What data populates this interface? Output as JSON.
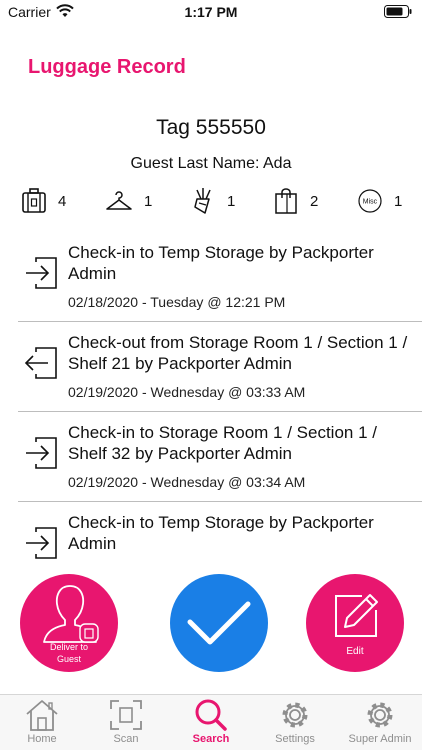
{
  "status_bar": {
    "carrier": "Carrier",
    "time": "1:17 PM"
  },
  "header": {
    "title": "Luggage Record"
  },
  "record": {
    "tag": "Tag 555550",
    "guest": "Guest Last Name: Ada"
  },
  "counts": [
    {
      "icon": "suitcase-icon",
      "value": "4"
    },
    {
      "icon": "hanger-icon",
      "value": "1"
    },
    {
      "icon": "golf-bag-icon",
      "value": "1"
    },
    {
      "icon": "shopping-bag-icon",
      "value": "2"
    },
    {
      "icon": "misc-icon",
      "value": "1",
      "icon_text": "Misc"
    }
  ],
  "history": [
    {
      "direction": "in",
      "text": "Check-in to Temp Storage by Packporter Admin",
      "date": "02/18/2020 - Tuesday @ 12:21 PM"
    },
    {
      "direction": "out",
      "text": "Check-out from Storage Room 1 / Section 1 / Shelf 21 by Packporter Admin",
      "date": "02/19/2020 - Wednesday @ 03:33 AM"
    },
    {
      "direction": "in",
      "text": "Check-in to Storage Room 1 / Section 1 / Shelf 32 by Packporter Admin",
      "date": "02/19/2020 - Wednesday @ 03:34 AM"
    },
    {
      "direction": "in",
      "text": "Check-in to Temp Storage by Packporter Admin",
      "date": ""
    }
  ],
  "actions": {
    "deliver_line1": "Deliver to",
    "deliver_line2": "Guest",
    "edit": "Edit"
  },
  "tabs": [
    {
      "label": "Home",
      "icon": "home-icon"
    },
    {
      "label": "Scan",
      "icon": "scan-icon"
    },
    {
      "label": "Search",
      "icon": "search-icon",
      "active": true
    },
    {
      "label": "Settings",
      "icon": "gear-icon"
    },
    {
      "label": "Super Admin",
      "icon": "gear-icon"
    }
  ],
  "colors": {
    "accent": "#e8166f",
    "confirm": "#1a7fe6"
  }
}
